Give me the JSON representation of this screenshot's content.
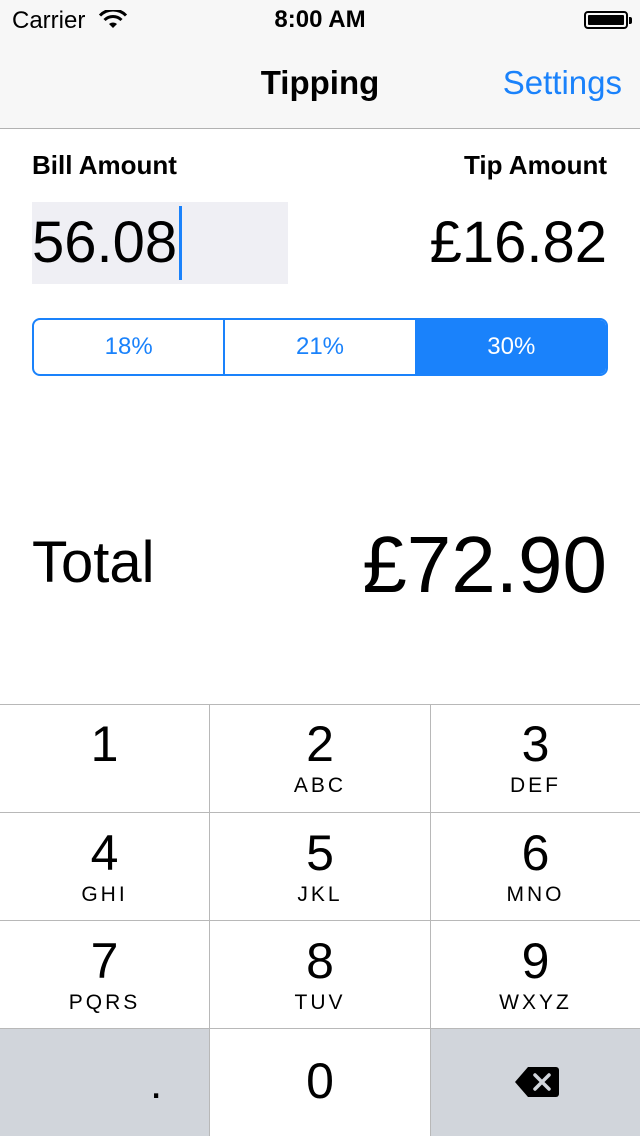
{
  "status_bar": {
    "carrier": "Carrier",
    "time": "8:00 AM"
  },
  "nav": {
    "title": "Tipping",
    "settings_label": "Settings"
  },
  "form": {
    "bill_label": "Bill Amount",
    "tip_label": "Tip Amount",
    "bill_value": "56.08",
    "tip_value": "£16.82"
  },
  "tip_options": [
    {
      "label": "18%"
    },
    {
      "label": "21%"
    },
    {
      "label": "30%"
    }
  ],
  "selected_tip": "30%",
  "total": {
    "label": "Total",
    "value": "£72.90"
  },
  "keypad": {
    "keys": [
      {
        "num": "1",
        "letters": ""
      },
      {
        "num": "2",
        "letters": "ABC"
      },
      {
        "num": "3",
        "letters": "DEF"
      },
      {
        "num": "4",
        "letters": "GHI"
      },
      {
        "num": "5",
        "letters": "JKL"
      },
      {
        "num": "6",
        "letters": "MNO"
      },
      {
        "num": "7",
        "letters": "PQRS"
      },
      {
        "num": "8",
        "letters": "TUV"
      },
      {
        "num": "9",
        "letters": "WXYZ"
      }
    ],
    "decimal": ".",
    "zero": "0"
  },
  "colors": {
    "accent": "#1a82fb",
    "keypad_gray": "#d1d5db"
  },
  "icons": {
    "wifi": "wifi-icon",
    "battery": "battery-icon",
    "backspace": "backspace-icon"
  }
}
